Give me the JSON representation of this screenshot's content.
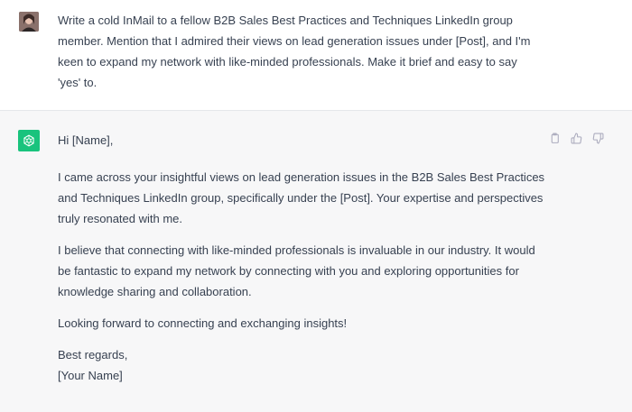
{
  "user_message": {
    "text": "Write a cold InMail to a fellow B2B Sales Best Practices and Techniques LinkedIn group member. Mention that I admired their views on lead generation issues under [Post], and I'm keen to expand my network with like-minded professionals. Make it brief and easy to say 'yes' to.",
    "avatar_icon": "user-avatar"
  },
  "assistant_message": {
    "avatar_icon": "chatgpt-logo-icon",
    "avatar_color": "#19c37d",
    "greeting": "Hi [Name],",
    "paragraph_1": "I came across your insightful views on lead generation issues in the B2B Sales Best Practices and Techniques LinkedIn group, specifically under the [Post]. Your expertise and perspectives truly resonated with me.",
    "paragraph_2": "I believe that connecting with like-minded professionals is invaluable in our industry. It would be fantastic to expand my network by connecting with you and exploring opportunities for knowledge sharing and collaboration.",
    "paragraph_3": "Looking forward to connecting and exchanging insights!",
    "sign_off": "Best regards,",
    "signature": "[Your Name]",
    "actions": [
      "copy-icon",
      "thumbs-up-icon",
      "thumbs-down-icon"
    ]
  },
  "colors": {
    "text": "#374151",
    "assistant_bg": "#f7f7f8",
    "icon_gray": "#acacbe"
  }
}
